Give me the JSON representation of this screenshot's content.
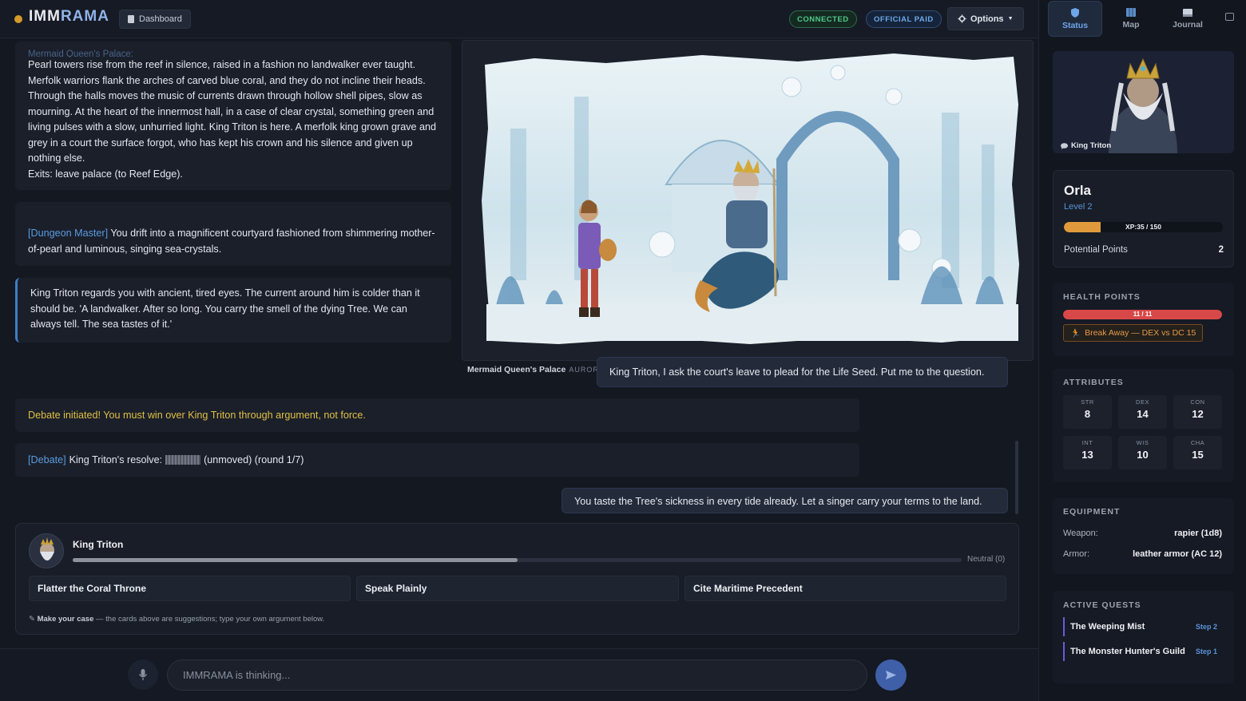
{
  "app": {
    "logo_main": "IMM",
    "logo_accent": "RAMA",
    "dashboard_label": "Dashboard",
    "status_connected": "CONNECTED",
    "status_paid": "OFFICIAL PAID",
    "options_label": "Options"
  },
  "chat": {
    "room_title_faded": "Mermaid Queen's Palace:",
    "room_description": "Pearl towers rise from the reef in silence, raised in a fashion no landwalker ever taught. Merfolk warriors flank the arches of carved blue coral, and they do not incline their heads. Through the halls moves the music of currents drawn through hollow shell pipes, slow as mourning. At the heart of the innermost hall, in a case of clear crystal, something green and living pulses with a slow, unhurried light. King Triton is here. A merfolk king grown grave and grey in a court the surface forgot, who has kept his crown and his silence and given up nothing else.",
    "room_exits": "Exits: leave palace (to Reef Edge).",
    "dm_tag": "[Dungeon Master]",
    "dm_text": "You drift into a magnificent courtyard fashioned from shimmering mother-of-pearl and luminous, singing sea-crystals.",
    "npc_text": "King Triton regards you with ancient, tired eyes. The current around him is colder than it should be. 'A landwalker. After so long. You carry the smell of the dying Tree. We can always tell. The sea tastes of it.'",
    "scene_caption": "Mermaid Queen's Palace",
    "scene_tag": "AURORAE",
    "user_msg_1": "King Triton, I ask the court's leave to plead for the Life Seed. Put me to the question.",
    "debate_start": "Debate initiated! You must win over King Triton through argument, not force.",
    "debate_tag": "[Debate]",
    "debate_resolve_prefix": "King Triton's resolve:",
    "debate_resolve_suffix": "(unmoved) (round 1/7)",
    "user_msg_2": "You taste the Tree's sickness in every tide already. Let a singer carry your terms to the land."
  },
  "debate": {
    "npc_name": "King Triton",
    "progress": 0.5,
    "status": "Neutral (0)",
    "suggestions": [
      "Flatter the Coral Throne",
      "Speak Plainly",
      "Cite Maritime Precedent"
    ],
    "hint_bold": "Make your case",
    "hint_rest": " — the cards above are suggestions; type your own argument below."
  },
  "input": {
    "placeholder": "IMMRAMA is thinking..."
  },
  "sidebar": {
    "tabs": [
      {
        "label": "Status",
        "icon": "shield-icon"
      },
      {
        "label": "Map",
        "icon": "map-icon"
      },
      {
        "label": "Journal",
        "icon": "book-icon"
      }
    ],
    "portrait_label": "King Triton",
    "character": {
      "name": "Orla",
      "level": "Level 2",
      "xp_text": "XP:35 / 150",
      "xp_fraction": 0.233,
      "potential_points_label": "Potential Points",
      "potential_points": "2"
    },
    "health": {
      "title": "HEALTH POINTS",
      "text": "11 / 11",
      "fraction": 1.0,
      "action": "Break Away — DEX vs DC 15"
    },
    "attributes": {
      "title": "ATTRIBUTES",
      "items": [
        {
          "name": "STR",
          "value": "8"
        },
        {
          "name": "DEX",
          "value": "14"
        },
        {
          "name": "CON",
          "value": "12"
        },
        {
          "name": "INT",
          "value": "13"
        },
        {
          "name": "WIS",
          "value": "10"
        },
        {
          "name": "CHA",
          "value": "15"
        }
      ]
    },
    "equipment": {
      "title": "EQUIPMENT",
      "weapon_label": "Weapon:",
      "weapon": "rapier (1d8)",
      "armor_label": "Armor:",
      "armor": "leather armor (AC 12)"
    },
    "quests": {
      "title": "ACTIVE QUESTS",
      "items": [
        {
          "name": "The Weeping Mist",
          "step": "Step 2"
        },
        {
          "name": "The Monster Hunter's Guild",
          "step": "Step 1"
        }
      ]
    }
  },
  "colors": {
    "accent_blue": "#5a9be0",
    "debate_yellow": "#e0c043",
    "xp_orange": "#e09a3b",
    "hp_red": "#d94848",
    "connected_green": "#4fc98b"
  }
}
